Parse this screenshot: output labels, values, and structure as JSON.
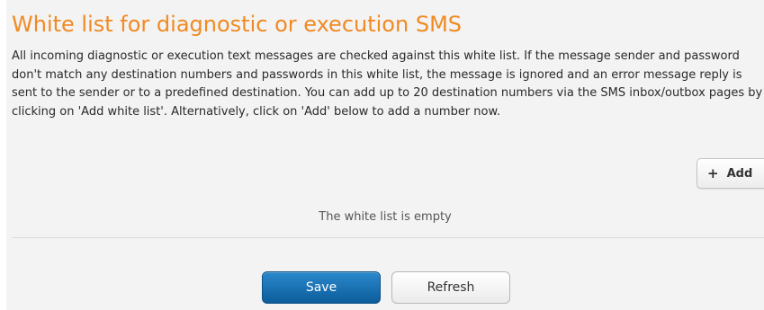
{
  "header": {
    "title": "White list for diagnostic or execution SMS"
  },
  "description": "All incoming diagnostic or execution text messages are checked against this white list. If the message sender and password don't match any destination numbers and passwords in this white list, the message is ignored and an error message reply is sent to the sender or to a predefined destination. You can add up to 20 destination numbers via the SMS inbox/outbox pages by clicking on 'Add white list'. Alternatively, click on 'Add' below to add a number now.",
  "toolbar": {
    "add_icon": "plus-icon",
    "add_label": "Add"
  },
  "whitelist": {
    "empty_message": "The white list is empty"
  },
  "actions": {
    "save_label": "Save",
    "refresh_label": "Refresh"
  },
  "colors": {
    "title": "#f08a22",
    "save_button": "#1a6fb0",
    "panel_background": "#f3f3f3"
  }
}
